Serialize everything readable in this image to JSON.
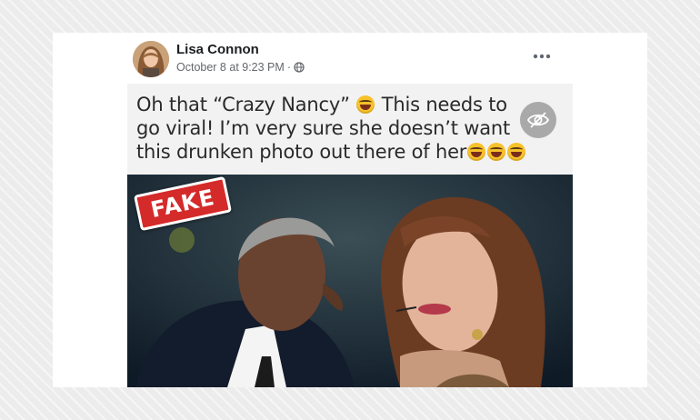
{
  "post": {
    "author_name": "Lisa Connon",
    "timestamp": "October 8 at 9:23 PM",
    "separator": "·",
    "privacy_icon": "globe-icon",
    "more_icon": "more-options-icon"
  },
  "meme": {
    "line1_a": "Oh that “Crazy Nancy”",
    "line1_b": "This needs to",
    "line2": "go viral! I’m very sure she doesn’t want",
    "line3": "this drunken photo out there of her",
    "emoji_icon": "laughing-emoji-icon",
    "hide_icon": "eye-slash-icon"
  },
  "stamp": {
    "label": "FAKE",
    "color": "#d42a2a"
  },
  "colors": {
    "card_bg": "#ffffff",
    "author": "#1c1e21",
    "meta": "#65676b"
  }
}
